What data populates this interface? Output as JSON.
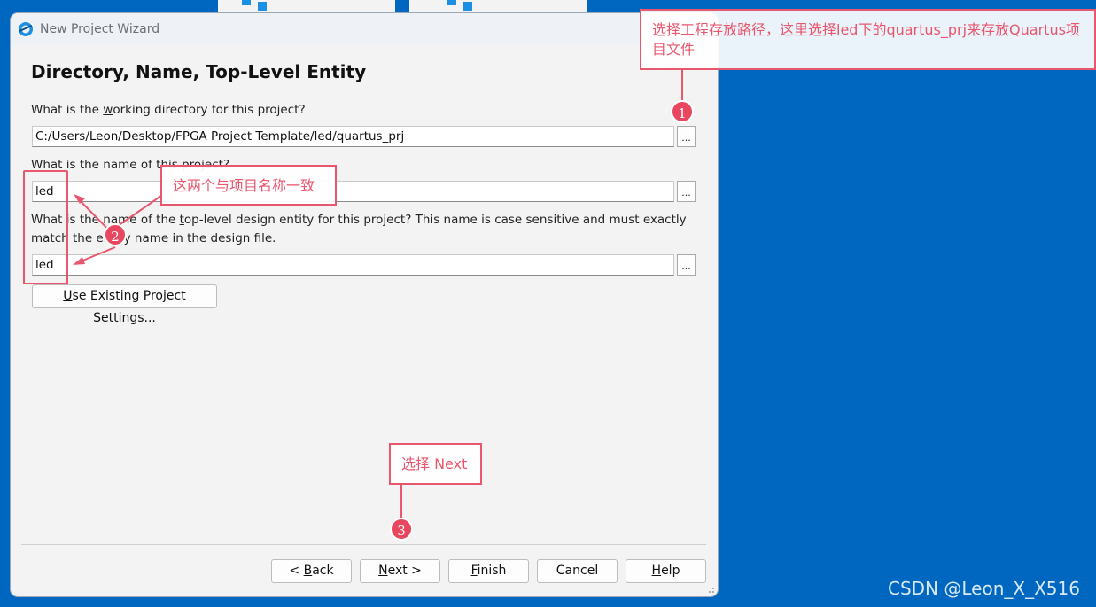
{
  "window": {
    "title": "New Project Wizard",
    "page_title": "Directory, Name, Top-Level Entity"
  },
  "directory": {
    "label_pre": "What is the ",
    "label_u": "w",
    "label_post": "orking directory for this project?",
    "value": "C:/Users/Leon/Desktop/FPGA Project Template/led/quartus_prj"
  },
  "name": {
    "label": "What is the name of this project?",
    "value": "led"
  },
  "entity": {
    "label_line1_pre": "What is the name of the ",
    "label_line1_u": "t",
    "label_line1_post": "op-level design entity for this project? This name is case sensitive and must exactly",
    "label_line2": "match the entity name in the design file.",
    "value": "led"
  },
  "browse_label": "...",
  "use_existing": {
    "u": "U",
    "rest": "se Existing Project Settings..."
  },
  "buttons": {
    "back_pre": "< ",
    "back_u": "B",
    "back_post": "ack",
    "next_u": "N",
    "next_post": "ext >",
    "finish_u": "F",
    "finish_post": "inish",
    "cancel": "Cancel",
    "help_u": "H",
    "help_post": "elp"
  },
  "annotations": {
    "note1": "选择工程存放路径，这里选择led下的quartus_prj来存放Quartus项目文件",
    "note2": "这两个与项目名称一致",
    "note3": "选择 Next",
    "badge1": "1",
    "badge2": "2",
    "badge3": "3",
    "color": "#e8576e"
  },
  "watermark": "CSDN @Leon_X_X516",
  "colors": {
    "desktop": "#0067c0",
    "window": "#f3f3f3",
    "accent_icon": "#1a8fe3"
  }
}
